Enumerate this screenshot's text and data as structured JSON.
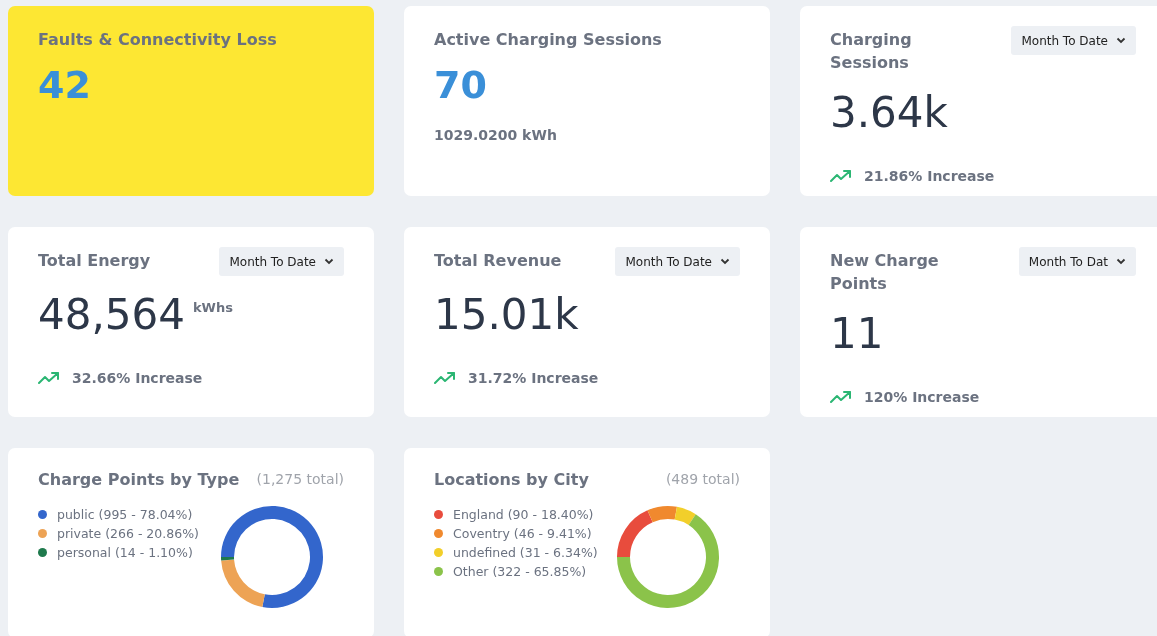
{
  "cards": [
    {
      "kind": "stat",
      "highlighted": true,
      "title": "Faults & Connectivity Loss",
      "value": "42"
    },
    {
      "kind": "stat",
      "highlighted": false,
      "title": "Active Charging Sessions",
      "value": "70",
      "subtext": "1029.0200 kWh"
    },
    {
      "kind": "metric",
      "title": "Charging Sessions",
      "dropdown": "Month To Date",
      "value": "3.64k",
      "trend": {
        "kind": "up",
        "text": "21.86% Increase"
      }
    },
    {
      "kind": "metric",
      "title": "Total Energy",
      "dropdown": "Month To Date",
      "value": "48,564",
      "unit": "kWhs",
      "trend": {
        "kind": "up",
        "text": "32.66% Increase"
      }
    },
    {
      "kind": "metric",
      "title": "Total Revenue",
      "dropdown": "Month To Date",
      "value": "15.01k",
      "trend": {
        "kind": "up",
        "text": "31.72% Increase"
      }
    },
    {
      "kind": "metric",
      "title": "New Charge Points",
      "dropdown": "Month To Dat",
      "value": "11",
      "trend": {
        "kind": "up",
        "text": "120% Increase"
      }
    },
    {
      "kind": "donut",
      "title": "Charge Points by Type",
      "total": "(1,275 total)",
      "legend_details": [
        "(995 - 78.04%)",
        "(266 - 20.86%)",
        "(14 - 1.10%)"
      ],
      "chart_data": {
        "type": "donut",
        "categories": [
          "public",
          "private",
          "personal"
        ],
        "values": [
          78.04,
          20.86,
          1.1
        ],
        "colors": [
          "#3366cc",
          "#eda355",
          "#1f7a4d"
        ]
      }
    },
    {
      "kind": "donut",
      "title": "Locations by City",
      "total": "(489 total)",
      "legend_details": [
        "(90 - 18.40%)",
        "(46 - 9.41%)",
        "(31 - 6.34%)",
        "(322 - 65.85%)"
      ],
      "chart_data": {
        "type": "donut",
        "categories": [
          "England",
          "Coventry",
          "undefined",
          "Other"
        ],
        "values": [
          18.4,
          9.41,
          6.34,
          65.85
        ],
        "colors": [
          "#e84c3d",
          "#f0892e",
          "#f2cf2a",
          "#8bc34a"
        ]
      }
    }
  ]
}
